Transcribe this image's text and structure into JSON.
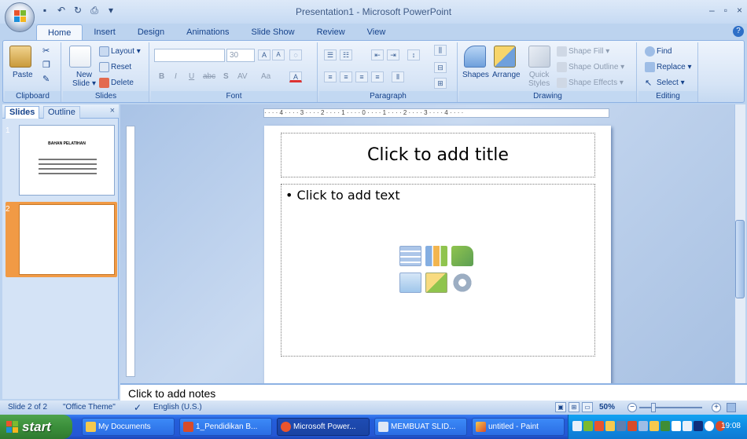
{
  "window": {
    "title": "Presentation1 - Microsoft PowerPoint",
    "controls": [
      "–",
      "▫",
      "×"
    ]
  },
  "qat": [
    "save",
    "undo",
    "redo",
    "print",
    "customize"
  ],
  "tabs": [
    "Home",
    "Insert",
    "Design",
    "Animations",
    "Slide Show",
    "Review",
    "View"
  ],
  "active_tab": "Home",
  "ribbon": {
    "clipboard": {
      "paste": "Paste",
      "label": "Clipboard"
    },
    "slides": {
      "new_slide_1": "New",
      "new_slide_2": "Slide",
      "layout": "Layout",
      "reset": "Reset",
      "delete": "Delete",
      "label": "Slides"
    },
    "font": {
      "size": "30",
      "bold": "B",
      "italic": "I",
      "underline": "U",
      "strike": "abc",
      "shadow": "S",
      "spacing": "AV",
      "case": "Aa",
      "color": "A",
      "grow": "A",
      "shrink": "A",
      "label": "Font"
    },
    "paragraph": {
      "label": "Paragraph"
    },
    "drawing": {
      "shapes": "Shapes",
      "arrange": "Arrange",
      "quick_styles_1": "Quick",
      "quick_styles_2": "Styles",
      "shape_fill": "Shape Fill",
      "shape_outline": "Shape Outline",
      "shape_effects": "Shape Effects",
      "label": "Drawing"
    },
    "editing": {
      "find": "Find",
      "replace": "Replace",
      "select": "Select",
      "label": "Editing"
    }
  },
  "panel": {
    "tab_slides": "Slides",
    "tab_outline": "Outline",
    "close": "×",
    "thumb1_num": "1",
    "thumb2_num": "2",
    "thumb1_title": "BAHAN PELATIHAN"
  },
  "ruler": {
    "h": "· · · · 4 · · · · 3 · · · · 2 · · · · 1 · · · · 0 · · · · 1 · · · · 2 · · · · 3 · · · · 4 · · · ·"
  },
  "slide": {
    "title_placeholder": "Click to add title",
    "body_placeholder": "• Click to add text"
  },
  "notes": {
    "placeholder": "Click to add notes"
  },
  "status": {
    "slide": "Slide 2 of 2",
    "theme": "\"Office Theme\"",
    "language": "English (U.S.)",
    "zoom": "50%"
  },
  "taskbar": {
    "start": "start",
    "items": [
      "My Documents",
      "1_Pendidikan B...",
      "Microsoft Power...",
      "MEMBUAT SLID...",
      "untitled - Paint"
    ],
    "clock": "19:08"
  },
  "colors": {
    "ribbon_text": "#15428b",
    "taskbar": "#245edb",
    "start": "#3b8f3b",
    "selected_thumb": "#f19a45"
  }
}
